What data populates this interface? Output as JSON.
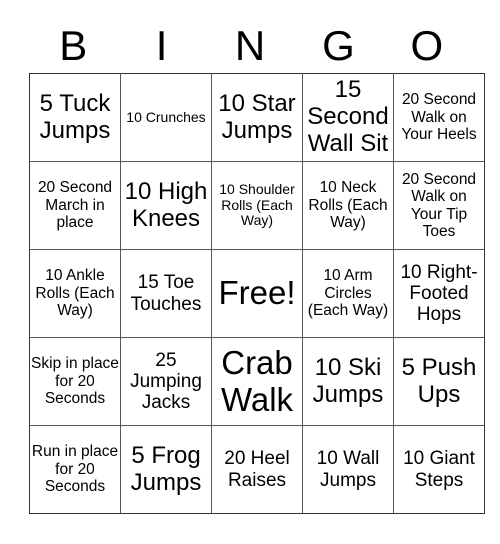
{
  "header": {
    "letters": [
      "B",
      "I",
      "N",
      "G",
      "O"
    ]
  },
  "grid": {
    "rows": [
      [
        {
          "text": "5 Tuck Jumps",
          "size": "l"
        },
        {
          "text": "10 Crunches",
          "size": "xs"
        },
        {
          "text": "10 Star Jumps",
          "size": "l"
        },
        {
          "text": "15 Second Wall Sit",
          "size": "l"
        },
        {
          "text": "20 Second Walk on Your Heels",
          "size": "s"
        }
      ],
      [
        {
          "text": "20 Second March in place",
          "size": "s"
        },
        {
          "text": "10 High Knees",
          "size": "l"
        },
        {
          "text": "10 Shoulder Rolls (Each Way)",
          "size": "xs"
        },
        {
          "text": "10 Neck Rolls (Each Way)",
          "size": "s"
        },
        {
          "text": "20 Second Walk on Your Tip Toes",
          "size": "s"
        }
      ],
      [
        {
          "text": "10 Ankle Rolls (Each Way)",
          "size": "s"
        },
        {
          "text": "15 Toe Touches",
          "size": "m"
        },
        {
          "text": "Free!",
          "size": "xl"
        },
        {
          "text": "10 Arm Circles (Each Way)",
          "size": "s"
        },
        {
          "text": "10 Right-Footed Hops",
          "size": "m"
        }
      ],
      [
        {
          "text": "Skip in place for 20 Seconds",
          "size": "s"
        },
        {
          "text": "25 Jumping Jacks",
          "size": "m"
        },
        {
          "text": "Crab Walk",
          "size": "xl"
        },
        {
          "text": "10 Ski Jumps",
          "size": "l"
        },
        {
          "text": "5 Push Ups",
          "size": "l"
        }
      ],
      [
        {
          "text": "Run in place for 20 Seconds",
          "size": "s"
        },
        {
          "text": "5 Frog Jumps",
          "size": "l"
        },
        {
          "text": "20 Heel Raises",
          "size": "m"
        },
        {
          "text": "10 Wall Jumps",
          "size": "m"
        },
        {
          "text": "10 Giant Steps",
          "size": "m"
        }
      ]
    ]
  }
}
